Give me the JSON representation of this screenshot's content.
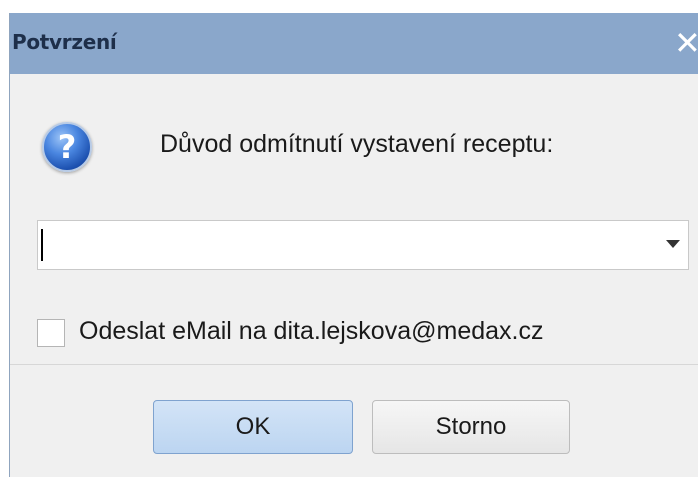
{
  "window": {
    "title": "Potvrzení",
    "close_glyph": "✕"
  },
  "icon": {
    "name": "question-icon",
    "glyph": "?",
    "color": "#2f67c8"
  },
  "prompt": {
    "text": "Důvod odmítnutí vystavení receptu:"
  },
  "reason_select": {
    "value": "",
    "options": []
  },
  "email_checkbox": {
    "label": "Odeslat eMail na dita.lejskova@medax.cz",
    "checked": false
  },
  "buttons": {
    "ok_label": "OK",
    "cancel_label": "Storno"
  },
  "colors": {
    "titlebar": "#8aa7cb",
    "dialog_bg": "#f0f0f0",
    "ok_button": "#c7dcf4"
  }
}
